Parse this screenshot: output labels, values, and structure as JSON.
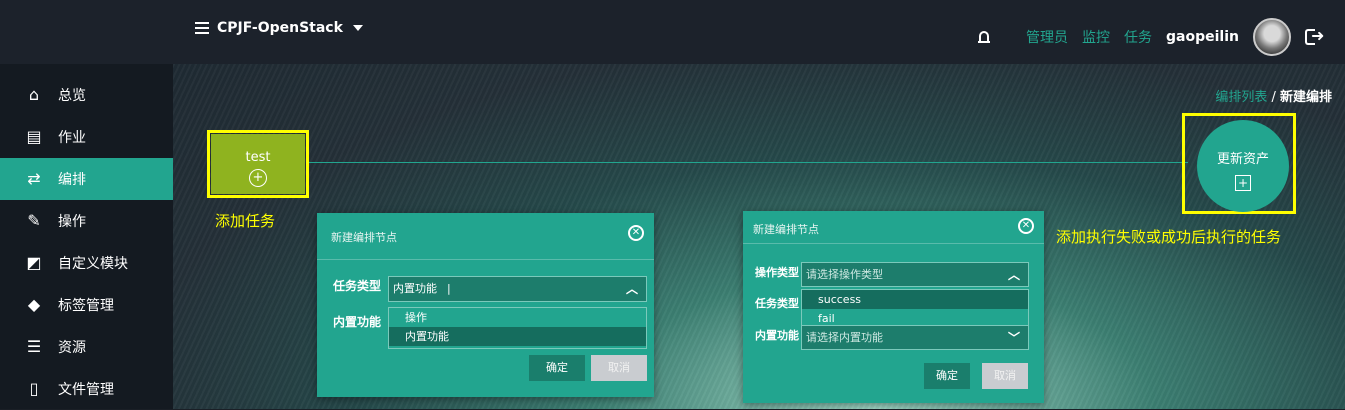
{
  "header": {
    "project": "CPJF-OpenStack",
    "nav_links": [
      "管理员",
      "监控",
      "任务"
    ],
    "username": "gaopeilin"
  },
  "sidebar": {
    "items": [
      {
        "label": "总览",
        "icon": "home-icon"
      },
      {
        "label": "作业",
        "icon": "clipboard-icon"
      },
      {
        "label": "编排",
        "icon": "flow-icon",
        "active": true
      },
      {
        "label": "操作",
        "icon": "wrench-icon"
      },
      {
        "label": "自定义模块",
        "icon": "module-icon"
      },
      {
        "label": "标签管理",
        "icon": "tags-icon"
      },
      {
        "label": "资源",
        "icon": "server-icon"
      },
      {
        "label": "文件管理",
        "icon": "file-code-icon"
      }
    ]
  },
  "breadcrumb": {
    "link": "编排列表",
    "sep": " / ",
    "current": "新建编排"
  },
  "canvas": {
    "task_node": {
      "label": "test"
    },
    "result_node": {
      "label": "更新资产"
    },
    "annotations": {
      "add_task": "添加任务",
      "add_result": "添加执行失败或成功后执行的任务"
    }
  },
  "modal_left": {
    "title": "新建编排节点",
    "task_type_label": "任务类型",
    "task_type_value": "内置功能",
    "builtin_label": "内置功能",
    "options": [
      "操作",
      "内置功能"
    ],
    "confirm": "确定",
    "cancel": "取消"
  },
  "modal_right": {
    "title": "新建编排节点",
    "op_type_label": "操作类型",
    "op_type_placeholder": "请选择操作类型",
    "task_type_label": "任务类型",
    "builtin_label": "内置功能",
    "builtin_placeholder": "请选择内置功能",
    "options": [
      "success",
      "fail"
    ],
    "confirm": "确定",
    "cancel": "取消"
  },
  "colors": {
    "accent": "#22a58f",
    "highlight": "#ffff00",
    "task_node": "#8fb31f"
  }
}
